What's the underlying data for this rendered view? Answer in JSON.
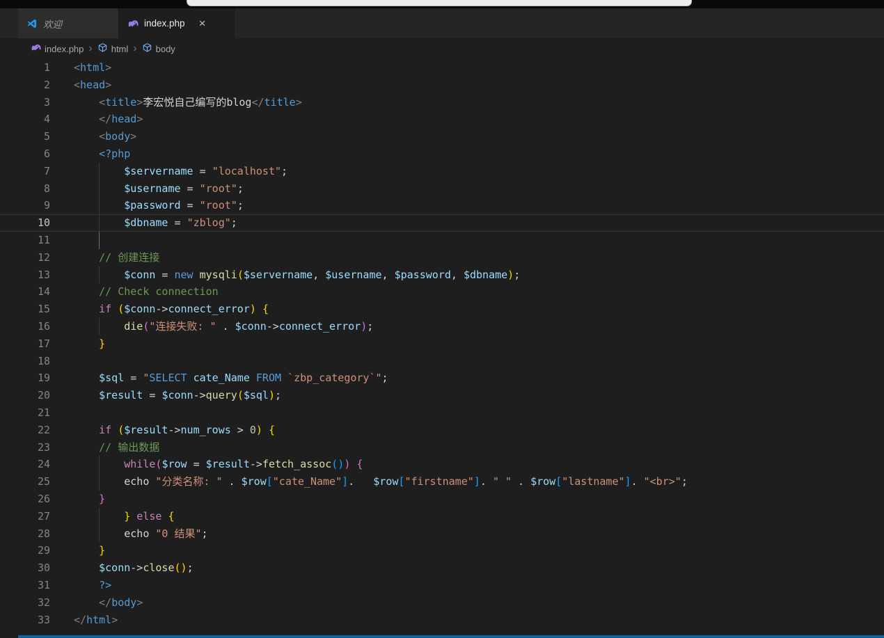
{
  "window": {
    "command_center_color": "#ececec",
    "titlebar_color": "#090909",
    "status_bar_color": "#0a64a8"
  },
  "tabs": [
    {
      "label": "欢迎",
      "icon": "vscode-logo",
      "active": false,
      "preview": true
    },
    {
      "label": "index.php",
      "icon": "php-elephant",
      "active": true,
      "close": "×"
    }
  ],
  "breadcrumb": {
    "separator": "›",
    "items": [
      {
        "label": "index.php",
        "icon": "php-elephant"
      },
      {
        "label": "html",
        "icon": "symbol-cube"
      },
      {
        "label": "body",
        "icon": "symbol-cube"
      }
    ]
  },
  "editor": {
    "current_line": 10,
    "palette": {
      "punct": "#808080",
      "tag": "#569CD6",
      "text": "#D4D4D4",
      "var": "#9CDCFE",
      "str": "#CE9178",
      "kw": "#C586C0",
      "kw2": "#569CD6",
      "fn": "#DCDCAA",
      "prop": "#9CDCFE",
      "comment": "#6A9955",
      "num": "#B5CEA8",
      "op": "#D4D4D4",
      "b1": "#FFD700",
      "b2": "#DA70D6",
      "b3": "#179FFF"
    },
    "lines": [
      {
        "n": 1,
        "indent": 0,
        "tokens": [
          [
            "punct",
            "<"
          ],
          [
            "tag",
            "html"
          ],
          [
            "punct",
            ">"
          ]
        ]
      },
      {
        "n": 2,
        "indent": 0,
        "tokens": [
          [
            "punct",
            "<"
          ],
          [
            "tag",
            "head"
          ],
          [
            "punct",
            ">"
          ]
        ]
      },
      {
        "n": 3,
        "indent": 4,
        "tokens": [
          [
            "punct",
            "<"
          ],
          [
            "tag",
            "title"
          ],
          [
            "punct",
            ">"
          ],
          [
            "text",
            "李宏悦自己编写的blog"
          ],
          [
            "punct",
            "</"
          ],
          [
            "tag",
            "title"
          ],
          [
            "punct",
            ">"
          ]
        ]
      },
      {
        "n": 4,
        "indent": 4,
        "tokens": [
          [
            "punct",
            "</"
          ],
          [
            "tag",
            "head"
          ],
          [
            "punct",
            ">"
          ]
        ]
      },
      {
        "n": 5,
        "indent": 4,
        "tokens": [
          [
            "punct",
            "<"
          ],
          [
            "tag",
            "body"
          ],
          [
            "punct",
            ">"
          ]
        ]
      },
      {
        "n": 6,
        "indent": 4,
        "tokens": [
          [
            "kw2",
            "<?php"
          ]
        ]
      },
      {
        "n": 7,
        "indent": 8,
        "guide": true,
        "tokens": [
          [
            "var",
            "$servername"
          ],
          [
            "op",
            " = "
          ],
          [
            "str",
            "\"localhost\""
          ],
          [
            "op",
            ";"
          ]
        ]
      },
      {
        "n": 8,
        "indent": 8,
        "guide": true,
        "tokens": [
          [
            "var",
            "$username"
          ],
          [
            "op",
            " = "
          ],
          [
            "str",
            "\"root\""
          ],
          [
            "op",
            ";"
          ]
        ]
      },
      {
        "n": 9,
        "indent": 8,
        "guide": true,
        "tokens": [
          [
            "var",
            "$password"
          ],
          [
            "op",
            " = "
          ],
          [
            "str",
            "\"root\""
          ],
          [
            "op",
            ";"
          ]
        ]
      },
      {
        "n": 10,
        "indent": 8,
        "guide": true,
        "tokens": [
          [
            "var",
            "$dbname"
          ],
          [
            "op",
            " = "
          ],
          [
            "str",
            "\"zblog\""
          ],
          [
            "op",
            ";"
          ]
        ]
      },
      {
        "n": 11,
        "indent": 0,
        "guide": "bright",
        "tokens": []
      },
      {
        "n": 12,
        "indent": 4,
        "tokens": [
          [
            "comment",
            "// 创建连接"
          ]
        ]
      },
      {
        "n": 13,
        "indent": 8,
        "guide": true,
        "tokens": [
          [
            "var",
            "$conn"
          ],
          [
            "op",
            " = "
          ],
          [
            "kw2",
            "new "
          ],
          [
            "fn",
            "mysqli"
          ],
          [
            "b1",
            "("
          ],
          [
            "var",
            "$servername"
          ],
          [
            "op",
            ", "
          ],
          [
            "var",
            "$username"
          ],
          [
            "op",
            ", "
          ],
          [
            "var",
            "$password"
          ],
          [
            "op",
            ", "
          ],
          [
            "var",
            "$dbname"
          ],
          [
            "b1",
            ")"
          ],
          [
            "op",
            ";"
          ]
        ]
      },
      {
        "n": 14,
        "indent": 4,
        "tokens": [
          [
            "comment",
            "// Check connection"
          ]
        ]
      },
      {
        "n": 15,
        "indent": 4,
        "tokens": [
          [
            "kw",
            "if "
          ],
          [
            "b1",
            "("
          ],
          [
            "var",
            "$conn"
          ],
          [
            "op",
            "->"
          ],
          [
            "prop",
            "connect_error"
          ],
          [
            "b1",
            ")"
          ],
          [
            "op",
            " "
          ],
          [
            "b1",
            "{"
          ]
        ]
      },
      {
        "n": 16,
        "indent": 8,
        "guide": true,
        "tokens": [
          [
            "fn",
            "die"
          ],
          [
            "b2",
            "("
          ],
          [
            "str",
            "\"连接失败: \""
          ],
          [
            "op",
            " . "
          ],
          [
            "var",
            "$conn"
          ],
          [
            "op",
            "->"
          ],
          [
            "prop",
            "connect_error"
          ],
          [
            "b2",
            ")"
          ],
          [
            "op",
            ";"
          ]
        ]
      },
      {
        "n": 17,
        "indent": 4,
        "tokens": [
          [
            "b1",
            "}"
          ]
        ]
      },
      {
        "n": 18,
        "indent": 0,
        "tokens": []
      },
      {
        "n": 19,
        "indent": 4,
        "tokens": [
          [
            "var",
            "$sql"
          ],
          [
            "op",
            " = "
          ],
          [
            "str",
            "\""
          ],
          [
            "kw2",
            "SELECT"
          ],
          [
            "str",
            " "
          ],
          [
            "prop",
            "cate_Name"
          ],
          [
            "str",
            " "
          ],
          [
            "kw2",
            "FROM"
          ],
          [
            "str",
            " `zbp_category`\""
          ],
          [
            "op",
            ";"
          ]
        ]
      },
      {
        "n": 20,
        "indent": 4,
        "tokens": [
          [
            "var",
            "$result"
          ],
          [
            "op",
            " = "
          ],
          [
            "var",
            "$conn"
          ],
          [
            "op",
            "->"
          ],
          [
            "fn",
            "query"
          ],
          [
            "b1",
            "("
          ],
          [
            "var",
            "$sql"
          ],
          [
            "b1",
            ")"
          ],
          [
            "op",
            ";"
          ]
        ]
      },
      {
        "n": 21,
        "indent": 0,
        "tokens": []
      },
      {
        "n": 22,
        "indent": 4,
        "tokens": [
          [
            "kw",
            "if "
          ],
          [
            "b1",
            "("
          ],
          [
            "var",
            "$result"
          ],
          [
            "op",
            "->"
          ],
          [
            "prop",
            "num_rows"
          ],
          [
            "op",
            " > "
          ],
          [
            "num",
            "0"
          ],
          [
            "b1",
            ")"
          ],
          [
            "op",
            " "
          ],
          [
            "b1",
            "{"
          ]
        ]
      },
      {
        "n": 23,
        "indent": 4,
        "tokens": [
          [
            "comment",
            "// 输出数据"
          ]
        ]
      },
      {
        "n": 24,
        "indent": 8,
        "guide": true,
        "tokens": [
          [
            "kw",
            "while"
          ],
          [
            "b2",
            "("
          ],
          [
            "var",
            "$row"
          ],
          [
            "op",
            " = "
          ],
          [
            "var",
            "$result"
          ],
          [
            "op",
            "->"
          ],
          [
            "fn",
            "fetch_assoc"
          ],
          [
            "b3",
            "()"
          ],
          [
            "b2",
            ")"
          ],
          [
            "op",
            " "
          ],
          [
            "b2",
            "{"
          ]
        ]
      },
      {
        "n": 25,
        "indent": 8,
        "guide": true,
        "tokens": [
          [
            "op",
            "echo "
          ],
          [
            "str",
            "\"分类名称: \""
          ],
          [
            "op",
            " . "
          ],
          [
            "var",
            "$row"
          ],
          [
            "b3",
            "["
          ],
          [
            "str",
            "\"cate_Name\""
          ],
          [
            "b3",
            "]"
          ],
          [
            "op",
            ".   "
          ],
          [
            "var",
            "$row"
          ],
          [
            "b3",
            "["
          ],
          [
            "str",
            "\"firstname\""
          ],
          [
            "b3",
            "]"
          ],
          [
            "op",
            ". "
          ],
          [
            "str",
            "\" \""
          ],
          [
            "op",
            " . "
          ],
          [
            "var",
            "$row"
          ],
          [
            "b3",
            "["
          ],
          [
            "str",
            "\"lastname\""
          ],
          [
            "b3",
            "]"
          ],
          [
            "op",
            ". "
          ],
          [
            "str",
            "\"<br>\""
          ],
          [
            "op",
            ";"
          ]
        ]
      },
      {
        "n": 26,
        "indent": 4,
        "tokens": [
          [
            "b2",
            "}"
          ]
        ]
      },
      {
        "n": 27,
        "indent": 8,
        "guide": true,
        "tokens": [
          [
            "b1",
            "}"
          ],
          [
            "kw",
            " else "
          ],
          [
            "b1",
            "{"
          ]
        ]
      },
      {
        "n": 28,
        "indent": 8,
        "guide": true,
        "tokens": [
          [
            "op",
            "echo "
          ],
          [
            "str",
            "\"0 结果\""
          ],
          [
            "op",
            ";"
          ]
        ]
      },
      {
        "n": 29,
        "indent": 4,
        "tokens": [
          [
            "b1",
            "}"
          ]
        ]
      },
      {
        "n": 30,
        "indent": 4,
        "tokens": [
          [
            "var",
            "$conn"
          ],
          [
            "op",
            "->"
          ],
          [
            "fn",
            "close"
          ],
          [
            "b1",
            "()"
          ],
          [
            "op",
            ";"
          ]
        ]
      },
      {
        "n": 31,
        "indent": 4,
        "tokens": [
          [
            "kw2",
            "?>"
          ]
        ]
      },
      {
        "n": 32,
        "indent": 4,
        "tokens": [
          [
            "punct",
            "</"
          ],
          [
            "tag",
            "body"
          ],
          [
            "punct",
            ">"
          ]
        ]
      },
      {
        "n": 33,
        "indent": 0,
        "tokens": [
          [
            "punct",
            "</"
          ],
          [
            "tag",
            "html"
          ],
          [
            "punct",
            ">"
          ]
        ]
      }
    ]
  }
}
